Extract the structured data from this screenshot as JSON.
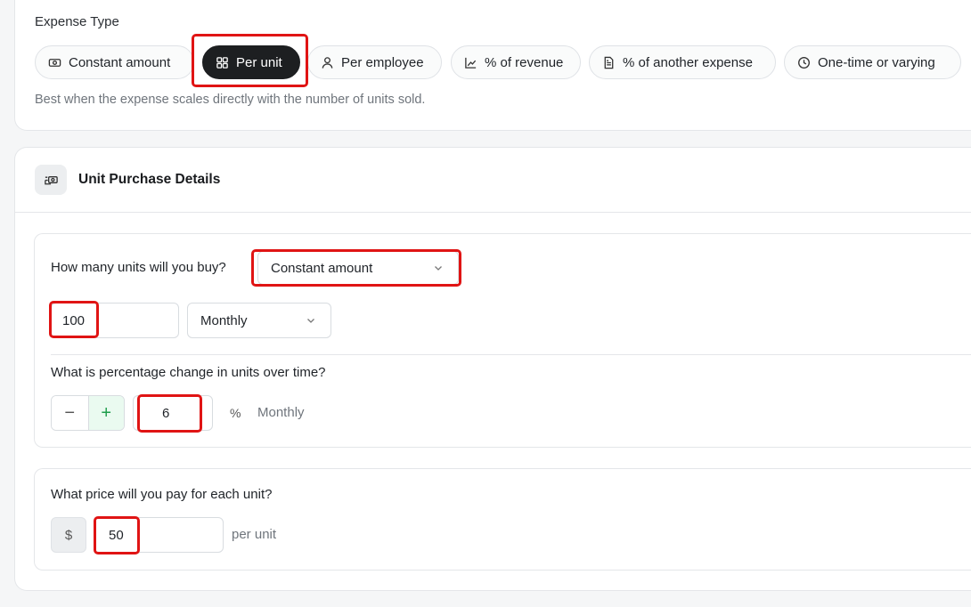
{
  "expense_type": {
    "label": "Expense Type",
    "options": [
      {
        "label": "Constant amount",
        "icon": "cash-icon"
      },
      {
        "label": "Per unit",
        "icon": "grid-icon",
        "selected": true
      },
      {
        "label": "Per employee",
        "icon": "person-icon"
      },
      {
        "label": "% of revenue",
        "icon": "chart-icon"
      },
      {
        "label": "% of another expense",
        "icon": "document-icon"
      },
      {
        "label": "One-time or varying",
        "icon": "clock-icon"
      }
    ],
    "hint": "Best when the expense scales directly with the number of units sold."
  },
  "unit_purchase": {
    "title": "Unit Purchase Details",
    "icon": "hand-cash-icon",
    "units_question": "How many units will you buy?",
    "units_mode": "Constant amount",
    "units_value": "100",
    "units_frequency": "Monthly",
    "change_question": "What is percentage change in units over time?",
    "change_value": "6",
    "change_unit": "%",
    "change_frequency": "Monthly",
    "price_question": "What price will you pay for each unit?",
    "currency": "$",
    "price_value": "50",
    "price_suffix": "per unit"
  },
  "colors": {
    "highlight": "#e01414",
    "active_chip": "#1d1f21",
    "plus_button": "#1f9d4c"
  }
}
